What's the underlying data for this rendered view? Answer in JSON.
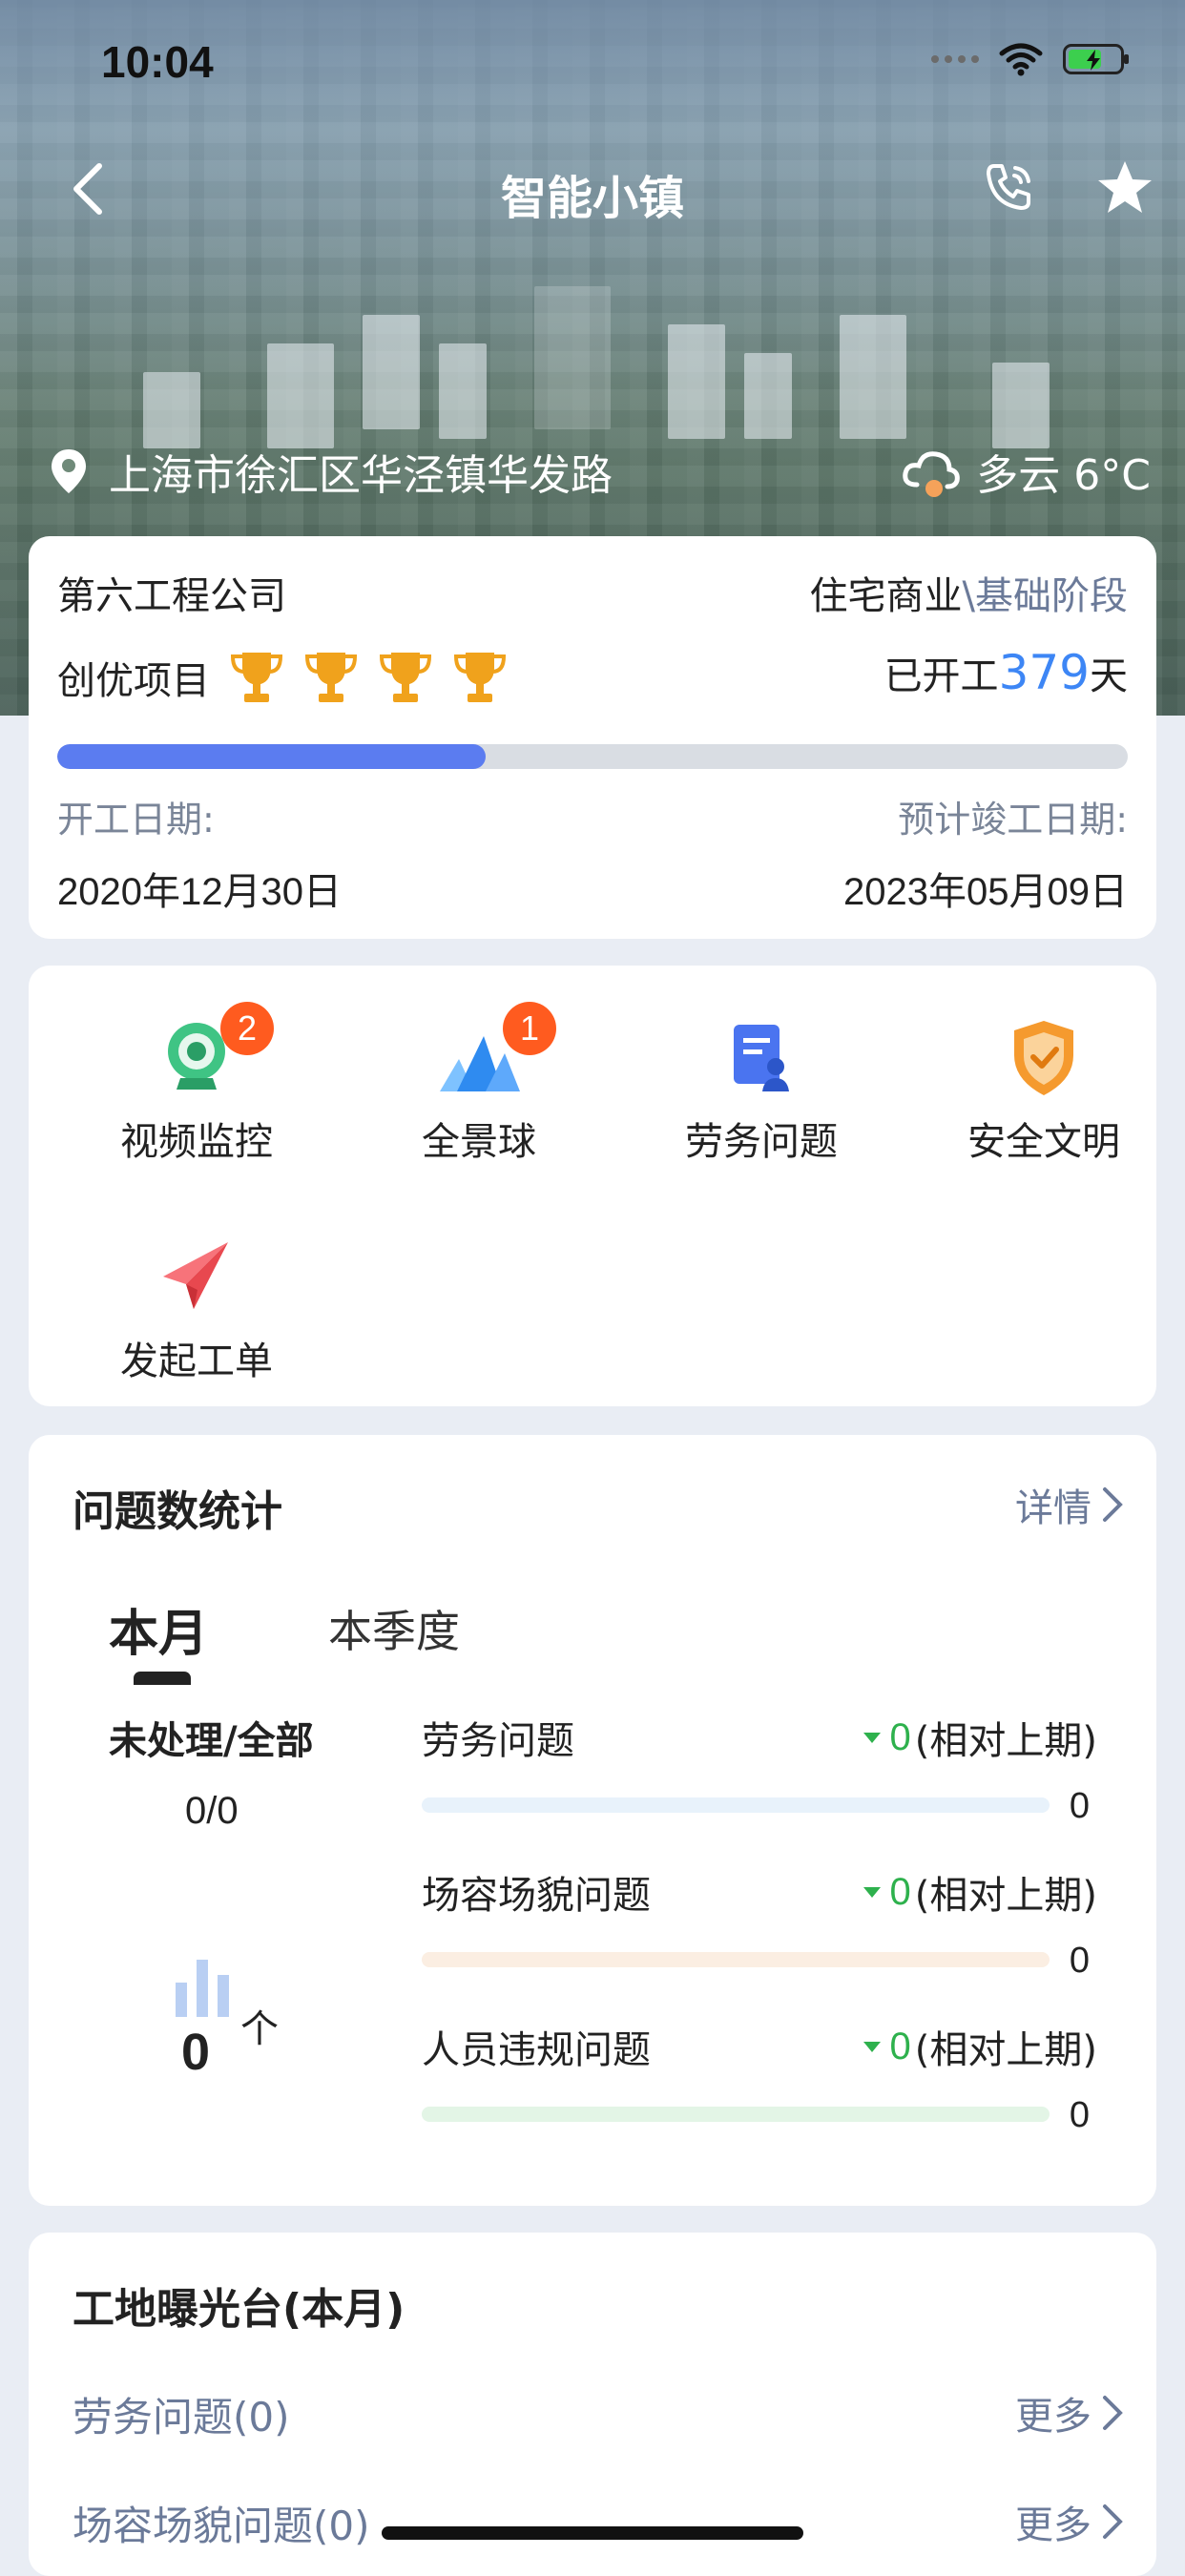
{
  "status_bar": {
    "time": "10:04"
  },
  "nav": {
    "title": "智能小镇",
    "back_icon": "chevron-left-icon",
    "phone_icon": "phone-icon",
    "star_icon": "star-icon"
  },
  "location": {
    "address": "上海市徐汇区华泾镇华发路",
    "weather": "多云 6°C"
  },
  "project": {
    "company": "第六工程公司",
    "type": "住宅商业",
    "stage": "\\基础阶段",
    "award_label": "创优项目",
    "trophy_count": 4,
    "days_prefix": "已开工",
    "days_value": "379",
    "days_suffix": "天",
    "progress": 0.4,
    "start_label": "开工日期:",
    "start_value": "2020年12月30日",
    "end_label": "预计竣工日期:",
    "end_value": "2023年05月09日"
  },
  "functions": [
    {
      "label": "视频监控",
      "badge": "2"
    },
    {
      "label": "全景球",
      "badge": "1"
    },
    {
      "label": "劳务问题"
    },
    {
      "label": "安全文明"
    },
    {
      "label": "发起工单"
    }
  ],
  "stats": {
    "title": "问题数统计",
    "detail": "详情",
    "tabs": [
      "本月",
      "本季度"
    ],
    "unprocessed_label": "未处理/全部",
    "unprocessed_value": "0/0",
    "count": "0",
    "count_unit": "个",
    "issues": [
      {
        "name": "劳务问题",
        "delta": "0",
        "delta_suffix": "(相对上期)",
        "value": "0",
        "color": "#e8f2fb"
      },
      {
        "name": "场容场貌问题",
        "delta": "0",
        "delta_suffix": "(相对上期)",
        "value": "0",
        "color": "#fbeee2"
      },
      {
        "name": "人员违规问题",
        "delta": "0",
        "delta_suffix": "(相对上期)",
        "value": "0",
        "color": "#e3f5e6"
      }
    ]
  },
  "exposure": {
    "title": "工地曝光台(本月)",
    "items": [
      {
        "label": "劳务问题(0)",
        "more": "更多"
      },
      {
        "label": "场容场貌问题(0)",
        "more": "更多"
      }
    ]
  }
}
